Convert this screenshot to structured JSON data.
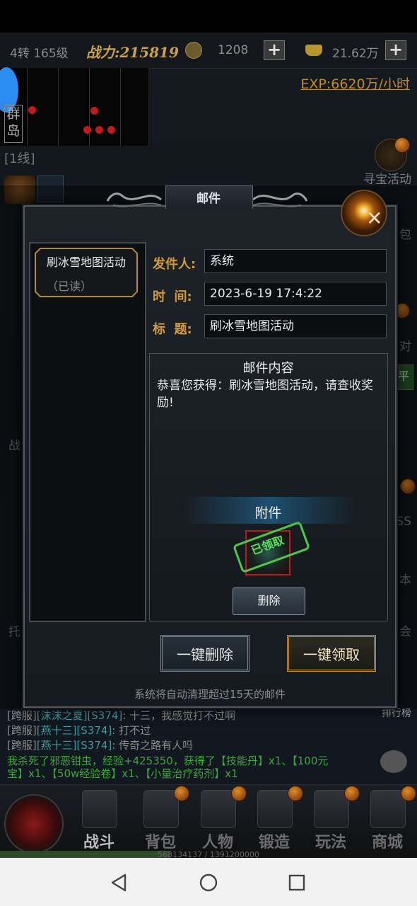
{
  "topbar": {
    "level_text": "4转 165级",
    "power_label": "战力:215819",
    "currency1": "1208",
    "currency2": "21.62万",
    "exp_rate": "EXP:6620万/小时"
  },
  "map": {
    "name": "群岛"
  },
  "line_label": "[1线]",
  "side_labels": {
    "treasure": "寻宝活动",
    "bag_partial": "包",
    "pair_partial": "对",
    "flat_partial": "平",
    "fight_partial": "战",
    "boss_partial": "SS",
    "book_partial": "本",
    "hold_partial": "托",
    "meet_partial": "会",
    "ranking": "排行榜"
  },
  "mail_dialog": {
    "title": "邮件",
    "list": [
      {
        "subject": "刷冰雪地图活动",
        "status": "（已读）"
      }
    ],
    "sender_label": "发件人:",
    "sender": "系统",
    "time_label": "时  间:",
    "time": "2023-6-19 17:4:22",
    "subject_label": "标  题:",
    "subject": "刷冰雪地图活动",
    "content_title": "邮件内容",
    "content_body": "恭喜您获得：刷冰雪地图活动，请查收奖励!",
    "attachments_title": "附件",
    "attachment_stamp": "已领取",
    "delete_label": "删除",
    "delete_all_label": "一键删除",
    "claim_all_label": "一键领取",
    "auto_clean_note": "系统将自动清理超过15天的邮件"
  },
  "chat": {
    "lines": [
      {
        "prefix": "[跨服]",
        "name": "[沫沫之夏][S374]",
        "text": ": 十三，我感觉打不过啊"
      },
      {
        "prefix": "[跨服]",
        "name": "[燕十三][S374]",
        "text": ": 打不过"
      },
      {
        "prefix": "[跨服]",
        "name": "[燕十三][S374]",
        "text": ": 传奇之路有人吗"
      }
    ],
    "kill_1": "我杀死了邪恶钳虫，经验+425350，获得了【技能丹】x1、【100元",
    "kill_2": "宝】x1、【50w经验卷】x1、【小量治疗药剂】x1"
  },
  "bottom_nav": {
    "items": [
      {
        "label": "战斗"
      },
      {
        "label": "背包"
      },
      {
        "label": "人物"
      },
      {
        "label": "锻造"
      },
      {
        "label": "玩法"
      },
      {
        "label": "商城"
      }
    ],
    "exp_text": "568134137 / 1391200000",
    "exp_fraction": 0.408
  },
  "colors": {
    "accent_gold": "#d29a3a",
    "claimed_green": "#4ac84a",
    "exp_orange": "#c08a2c"
  }
}
